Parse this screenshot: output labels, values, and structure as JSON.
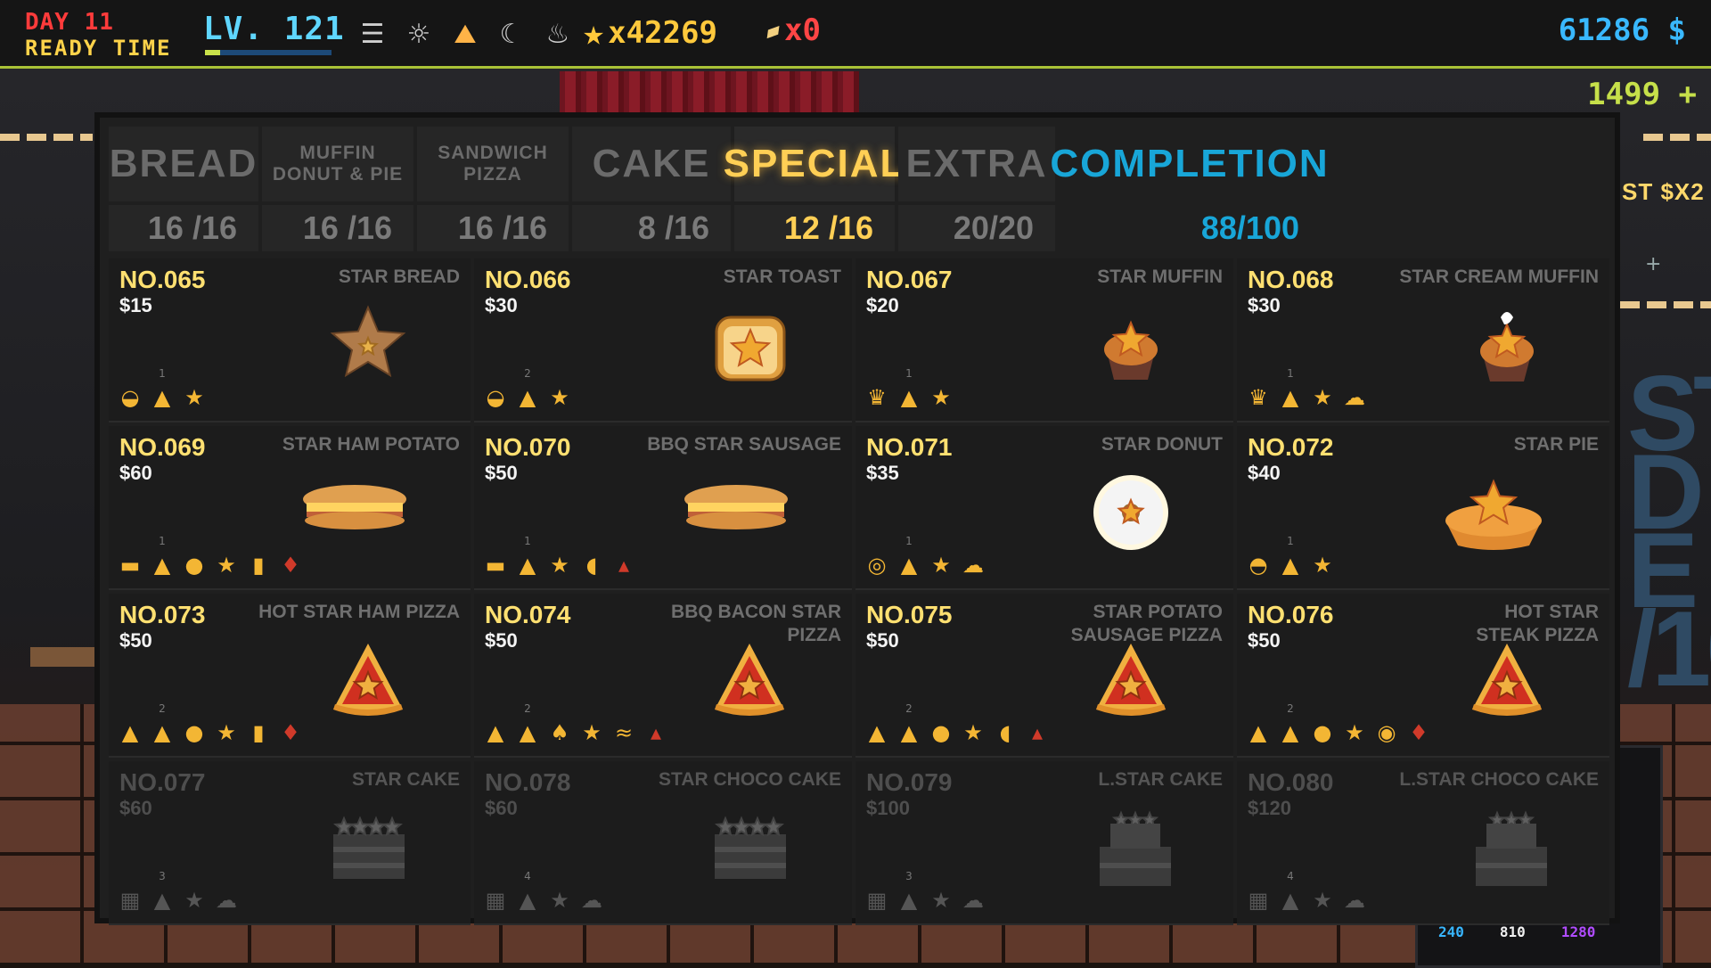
{
  "hud": {
    "day": "DAY 11",
    "phase": "READY TIME",
    "level": "LV. 121",
    "level_progress": 0.12,
    "time_icons": [
      "dawn-icon",
      "sun-icon",
      "sunset-icon",
      "moon-icon",
      "bowl-icon"
    ],
    "stars": "x42269",
    "tickets": "x0",
    "money": "61286 $",
    "subtotal": "1499 +"
  },
  "side": {
    "text": "ST $X2",
    "bottom_stats": [
      "240",
      "810",
      "1280"
    ]
  },
  "tabs": [
    {
      "label": "BREAD",
      "count": "16 /16"
    },
    {
      "label": "MUFFIN\nDONUT & PIE",
      "count": "16 /16"
    },
    {
      "label": "SANDWICH\nPIZZA",
      "count": "16 /16"
    },
    {
      "label": "CAKE",
      "count": "8 /16"
    },
    {
      "label": "SPECIAL",
      "count": "12 /16",
      "active": true
    },
    {
      "label": "EXTRA",
      "count": "20/20"
    },
    {
      "label": "COMPLETION",
      "count": "88/100"
    }
  ],
  "recipes": [
    {
      "no": "NO.065",
      "price": "$15",
      "name": "STAR BREAD",
      "dish": "star",
      "ingredients": [
        "bread",
        "dough:1",
        "star"
      ]
    },
    {
      "no": "NO.066",
      "price": "$30",
      "name": "STAR TOAST",
      "dish": "toast",
      "ingredients": [
        "bread",
        "dough:2",
        "star"
      ]
    },
    {
      "no": "NO.067",
      "price": "$20",
      "name": "STAR MUFFIN",
      "dish": "muffin",
      "ingredients": [
        "muffin",
        "dough:1",
        "star"
      ]
    },
    {
      "no": "NO.068",
      "price": "$30",
      "name": "STAR CREAM MUFFIN",
      "dish": "cream-muffin",
      "ingredients": [
        "muffin",
        "dough:1",
        "star",
        "cream"
      ]
    },
    {
      "no": "NO.069",
      "price": "$60",
      "name": "STAR HAM POTATO",
      "dish": "sandwich",
      "ingredients": [
        "bun",
        "dough:1",
        "potato",
        "star",
        "ham",
        "sauce"
      ]
    },
    {
      "no": "NO.070",
      "price": "$50",
      "name": "BBQ STAR SAUSAGE",
      "dish": "sandwich",
      "ingredients": [
        "bun",
        "dough:1",
        "star",
        "sausage",
        "bbq"
      ]
    },
    {
      "no": "NO.071",
      "price": "$35",
      "name": "STAR DONUT",
      "dish": "donut",
      "ingredients": [
        "donut",
        "dough:1",
        "star",
        "cream"
      ]
    },
    {
      "no": "NO.072",
      "price": "$40",
      "name": "STAR PIE",
      "dish": "pie",
      "ingredients": [
        "pie",
        "dough:1",
        "star"
      ]
    },
    {
      "no": "NO.073",
      "price": "$50",
      "name": "HOT STAR HAM PIZZA",
      "dish": "pizza",
      "ingredients": [
        "crust",
        "dough:2",
        "cheese",
        "star",
        "ham",
        "sauce"
      ]
    },
    {
      "no": "NO.074",
      "price": "$50",
      "name": "BBQ BACON STAR\nPIZZA",
      "dish": "pizza",
      "ingredients": [
        "crust",
        "dough:2",
        "mushroom",
        "star",
        "bacon",
        "bbq"
      ]
    },
    {
      "no": "NO.075",
      "price": "$50",
      "name": "STAR POTATO\nSAUSAGE PIZZA",
      "dish": "pizza",
      "ingredients": [
        "crust",
        "dough:2",
        "potato",
        "star",
        "sausage",
        "bbq"
      ]
    },
    {
      "no": "NO.076",
      "price": "$50",
      "name": "HOT STAR\nSTEAK PIZZA",
      "dish": "pizza",
      "ingredients": [
        "crust",
        "dough:2",
        "potato",
        "star",
        "steak",
        "sauce"
      ]
    },
    {
      "no": "NO.077",
      "price": "$60",
      "name": "STAR CAKE",
      "dish": "cake",
      "locked": true,
      "ingredients": [
        "cake",
        "dough:3",
        "star",
        "cream"
      ]
    },
    {
      "no": "NO.078",
      "price": "$60",
      "name": "STAR CHOCO CAKE",
      "dish": "cake",
      "locked": true,
      "ingredients": [
        "cake",
        "dough:4",
        "star",
        "cream"
      ]
    },
    {
      "no": "NO.079",
      "price": "$100",
      "name": "L.STAR CAKE",
      "dish": "big-cake",
      "locked": true,
      "ingredients": [
        "cake",
        "dough:3",
        "star",
        "cream"
      ]
    },
    {
      "no": "NO.080",
      "price": "$120",
      "name": "L.STAR CHOCO CAKE",
      "dish": "big-cake",
      "locked": true,
      "ingredients": [
        "cake",
        "dough:4",
        "star",
        "cream"
      ]
    }
  ]
}
